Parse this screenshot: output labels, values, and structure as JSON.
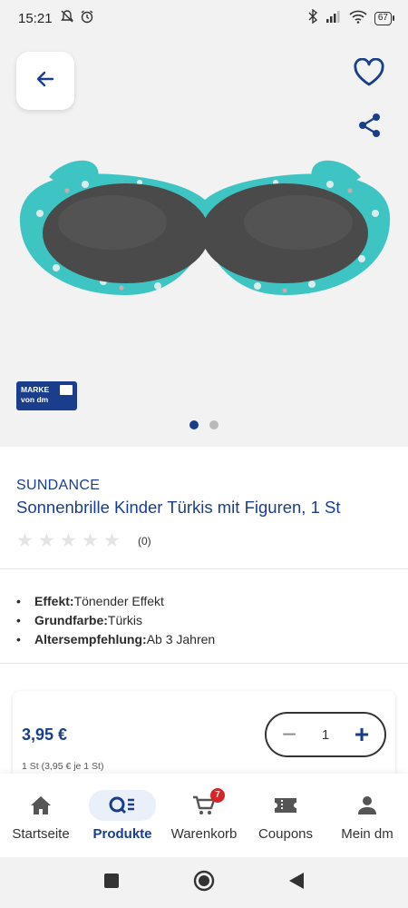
{
  "status_bar": {
    "time": "15:21",
    "battery": "67",
    "icons": [
      "muted-notifications-icon",
      "alarm-icon",
      "bluetooth-icon",
      "signal-icon",
      "wifi-icon",
      "battery-icon"
    ]
  },
  "gallery": {
    "badge_line1": "MARKE",
    "badge_line2": "von dm",
    "image_count": 2,
    "active_image": 1
  },
  "product": {
    "brand": "SUNDANCE",
    "title": "Sonnenbrille Kinder Türkis mit Figuren, 1 St",
    "rating_stars": 0,
    "rating_count": "(0)",
    "attributes": [
      {
        "name": "Effekt:",
        "value": " Tönender Effekt"
      },
      {
        "name": "Grundfarbe:",
        "value": " Türkis"
      },
      {
        "name": "Altersempfehlung:",
        "value": " Ab 3 Jahren"
      }
    ]
  },
  "purchase": {
    "price": "3,95 €",
    "unit_price": "1 St (3,95 € je 1 St)",
    "quantity": "1",
    "minus_label": "−",
    "plus_label": "+"
  },
  "bottom_nav": {
    "items": [
      {
        "label": "Startseite",
        "icon": "home-icon"
      },
      {
        "label": "Produkte",
        "icon": "product-search-icon"
      },
      {
        "label": "Warenkorb",
        "icon": "cart-icon"
      },
      {
        "label": "Coupons",
        "icon": "coupon-icon"
      },
      {
        "label": "Mein dm",
        "icon": "person-icon"
      }
    ],
    "active": "Produkte",
    "cart_count": "7"
  },
  "colors": {
    "brand_blue": "#1a3e8c",
    "frame_teal": "#3fc4c4",
    "badge_red": "#d4252b"
  }
}
